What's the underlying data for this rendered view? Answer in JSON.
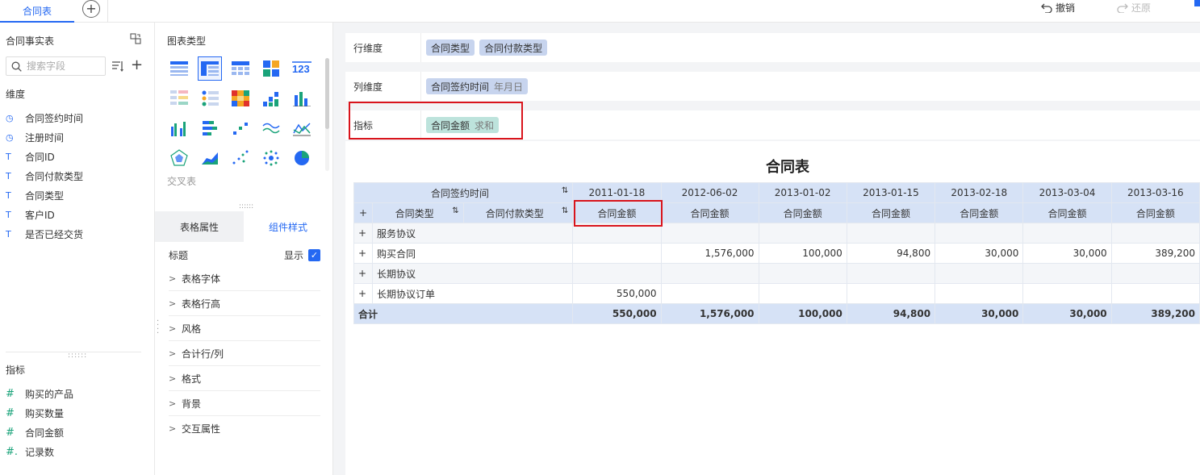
{
  "topbar": {
    "active_tab": "合同表",
    "undo_label": "撤销",
    "redo_label": "还原"
  },
  "fields_panel": {
    "title": "合同事实表",
    "search_placeholder": "搜索字段",
    "dimension_label": "维度",
    "dimensions": [
      {
        "icon": "clock-icon",
        "label": "合同签约时间"
      },
      {
        "icon": "clock-icon",
        "label": "注册时间"
      },
      {
        "icon": "text-type-icon",
        "label": "合同ID"
      },
      {
        "icon": "text-type-icon",
        "label": "合同付款类型"
      },
      {
        "icon": "text-type-icon",
        "label": "合同类型"
      },
      {
        "icon": "text-type-icon",
        "label": "客户ID"
      },
      {
        "icon": "text-type-icon",
        "label": "是否已经交货"
      }
    ],
    "measure_label": "指标",
    "measures": [
      {
        "icon": "number-type-icon",
        "label": "购买的产品"
      },
      {
        "icon": "number-type-icon",
        "label": "购买数量"
      },
      {
        "icon": "number-type-icon",
        "label": "合同金额"
      },
      {
        "icon": "count-type-icon",
        "label": "记录数"
      }
    ]
  },
  "chart_panel": {
    "title": "图表类型",
    "cross_table_label": "交叉表",
    "tabs": [
      "表格属性",
      "组件样式"
    ],
    "active_tab": "组件样式",
    "title_prop_label": "标题",
    "show_label": "显示",
    "properties": [
      "表格字体",
      "表格行高",
      "风格",
      "合计行/列",
      "格式",
      "背景",
      "交互属性"
    ]
  },
  "shelves": {
    "row_label": "行维度",
    "row_pills": [
      "合同类型",
      "合同付款类型"
    ],
    "col_label": "列维度",
    "col_pill": "合同签约时间",
    "col_pill_sub": "年月日",
    "measure_label": "指标",
    "measure_pill": "合同金额",
    "measure_pill_sub": "求和"
  },
  "report": {
    "title": "合同表",
    "col_header_field": "合同签约时间",
    "row_header_fields": [
      "合同类型",
      "合同付款类型"
    ],
    "dates": [
      "2011-01-18",
      "2012-06-02",
      "2013-01-02",
      "2013-01-15",
      "2013-02-18",
      "2013-03-04",
      "2013-03-16"
    ],
    "measure_name": "合同金额",
    "expand_symbol": "+",
    "rows": [
      {
        "label": "服务协议",
        "values": [
          "",
          "",
          "",
          "",
          "",
          "",
          ""
        ]
      },
      {
        "label": "购买合同",
        "values": [
          "",
          "1,576,000",
          "100,000",
          "94,800",
          "30,000",
          "30,000",
          "389,200"
        ]
      },
      {
        "label": "长期协议",
        "values": [
          "",
          "",
          "",
          "",
          "",
          "",
          ""
        ]
      },
      {
        "label": "长期协议订单",
        "values": [
          "550,000",
          "",
          "",
          "",
          "",
          "",
          ""
        ]
      }
    ],
    "total_label": "合计",
    "totals": [
      "550,000",
      "1,576,000",
      "100,000",
      "94,800",
      "30,000",
      "30,000",
      "389,200"
    ]
  }
}
